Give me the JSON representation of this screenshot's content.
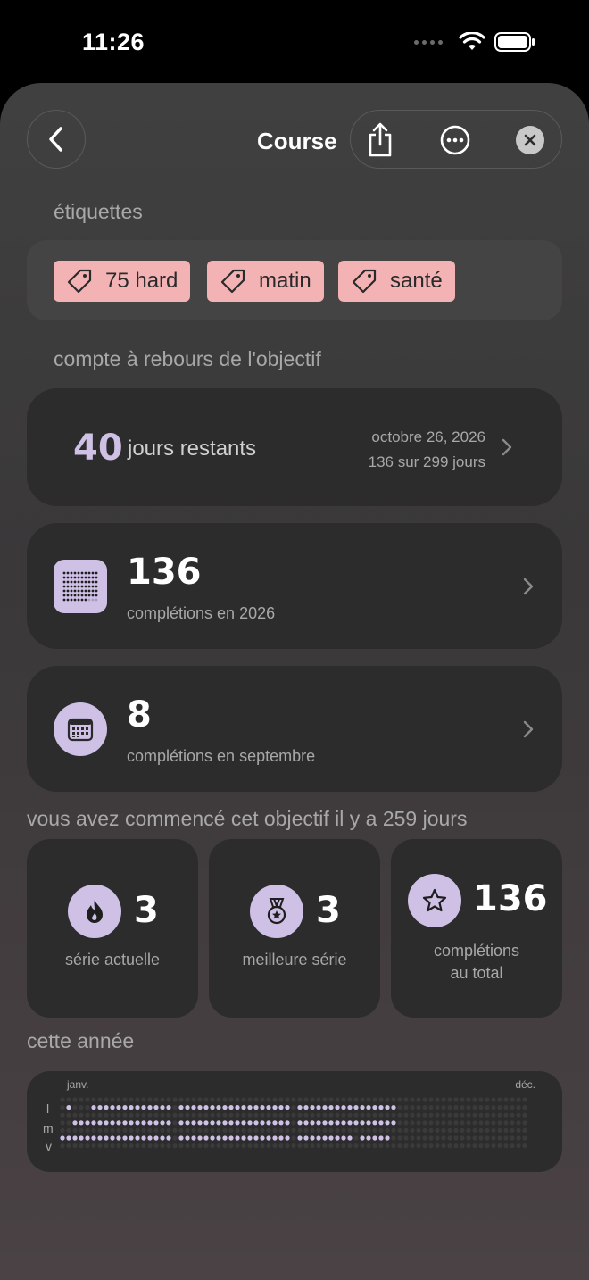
{
  "status": {
    "time": "11:26"
  },
  "header": {
    "title": "Course"
  },
  "tags": {
    "label": "étiquettes",
    "items": [
      "75 hard",
      "matin",
      "santé"
    ]
  },
  "countdown": {
    "label": "compte à rebours de l'objectif",
    "days": "40",
    "days_text": "jours restants",
    "date": "octobre 26, 2026",
    "progress": "136 sur 299 jours"
  },
  "year_completions": {
    "value": "136",
    "caption": "complétions en 2026"
  },
  "month_completions": {
    "value": "8",
    "caption": "complétions en septembre"
  },
  "started": {
    "text": "vous avez commencé cet objectif il y a 259 jours"
  },
  "stats": {
    "current": {
      "value": "3",
      "label": "série actuelle"
    },
    "best": {
      "value": "3",
      "label": "meilleure série"
    },
    "total": {
      "value": "136",
      "label_line1": "complétions",
      "label_line2": "au total"
    }
  },
  "year": {
    "label": "cette année",
    "start_month": "janv.",
    "end_month": "déc.",
    "rows": [
      "l",
      "m",
      "v"
    ]
  },
  "colors": {
    "accent": "#cfc1e6",
    "tag": "#f3b2b4",
    "card": "#2c2c2d"
  }
}
